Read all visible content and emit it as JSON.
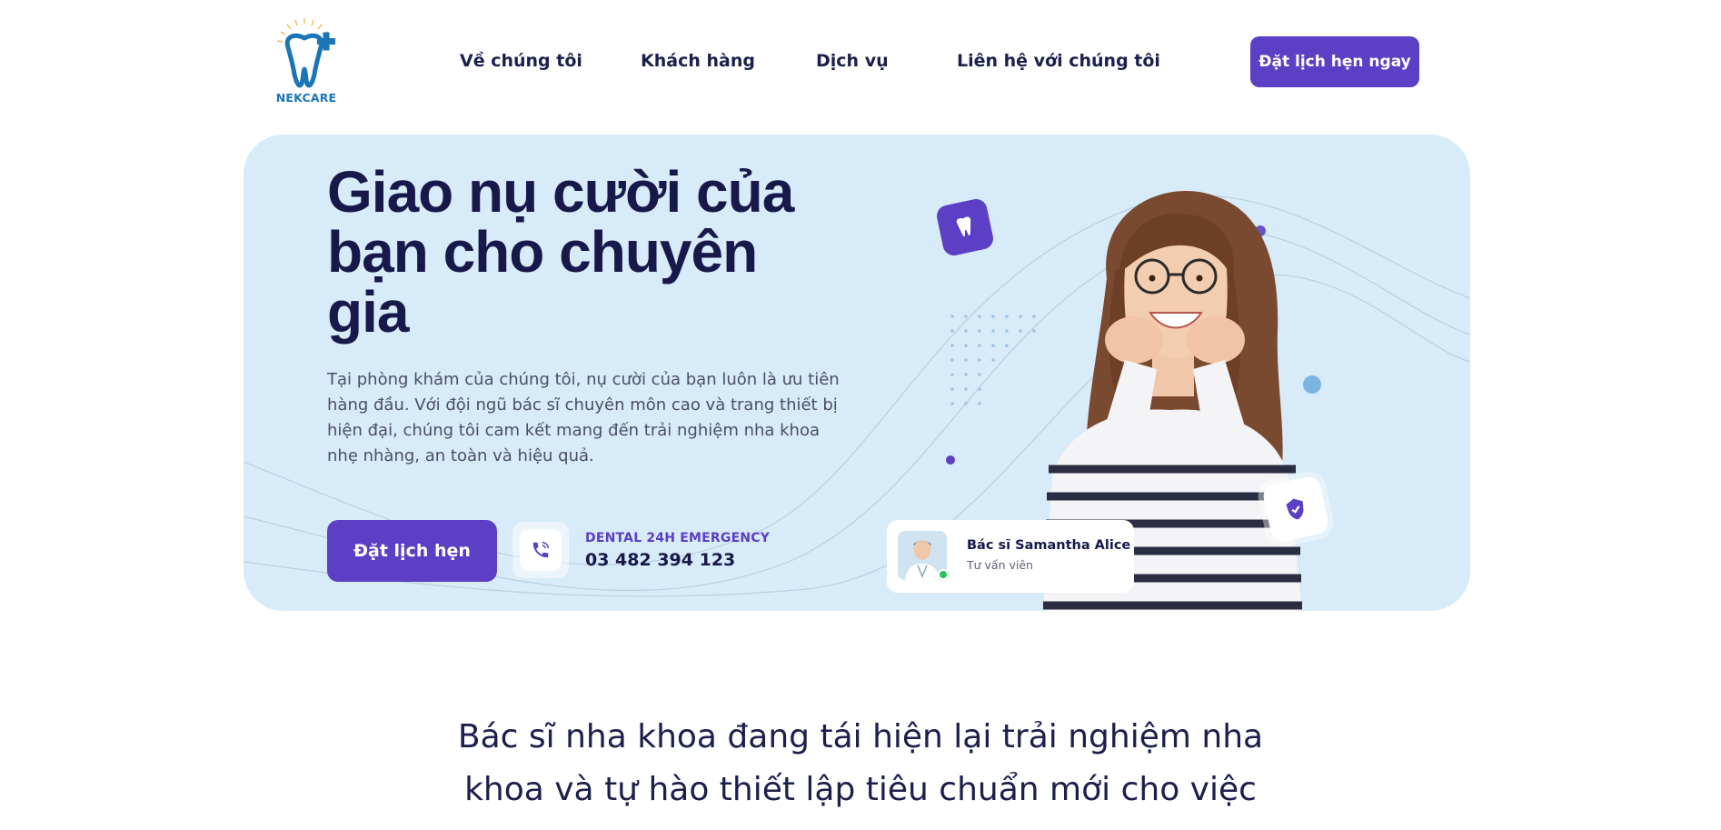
{
  "brand": {
    "name": "NEKCARE",
    "logo_icon": "tooth-plus-icon",
    "primary_color": "#5b3fc4",
    "accent_color": "#1a76b8",
    "hero_bg": "#d8ebf8",
    "heading_color": "#17194a"
  },
  "nav": {
    "items": [
      "Về chúng tôi",
      "Khách hàng",
      "Dịch vụ",
      "Liên hệ với chúng tôi"
    ],
    "cta_label": "Đặt lịch hẹn ngay"
  },
  "hero": {
    "title": "Giao nụ cười của\nbạn cho chuyên\ngia",
    "description": "Tại phòng khám của chúng tôi, nụ cười của bạn luôn là ưu tiên hàng đầu. Với đội ngũ bác sĩ chuyên môn cao và trang thiết bị hiện đại, chúng tôi cam kết mang đến trải nghiệm nha khoa nhẹ nhàng, an toàn và hiệu quả.",
    "book_button": "Đặt lịch hẹn",
    "emergency": {
      "label": "DENTAL 24H EMERGENCY",
      "phone": "03 482 394 123",
      "icon": "phone-icon"
    },
    "doctor_card": {
      "name": "Bác sĩ Samantha Alice",
      "role": "Tư vấn viên",
      "status": "online"
    },
    "floating_icons": [
      "tooth-icon",
      "check-shield-icon"
    ]
  },
  "mission": {
    "heading": "Bác sĩ nha khoa đang tái hiện lại trải nghiệm nha khoa và tự hào thiết lập tiêu chuẩn mới cho việc"
  }
}
